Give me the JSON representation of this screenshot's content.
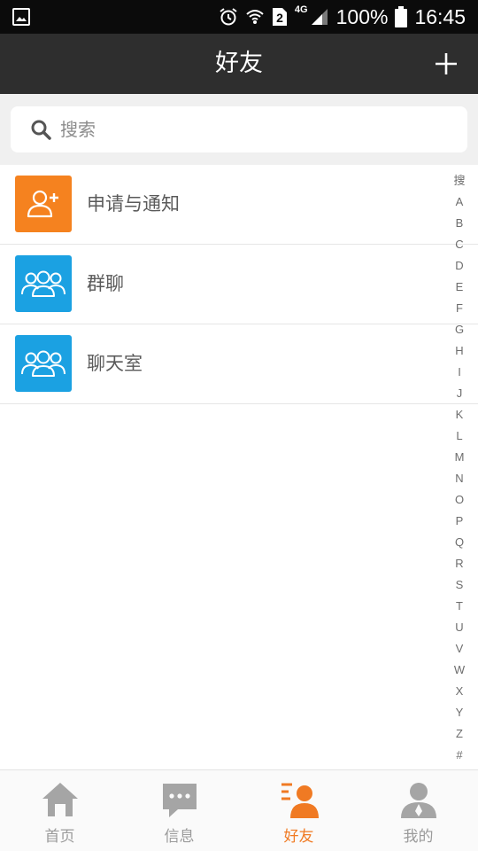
{
  "status_bar": {
    "network": "4G",
    "sim": "2",
    "battery": "100%",
    "time": "16:45"
  },
  "header": {
    "title": "好友",
    "add_icon": "plus-icon"
  },
  "search": {
    "placeholder": "搜索",
    "value": ""
  },
  "list": {
    "items": [
      {
        "label": "申请与通知",
        "icon": "add-user-icon",
        "color": "#f5821f"
      },
      {
        "label": "群聊",
        "icon": "group-icon",
        "color": "#1ba1e2"
      },
      {
        "label": "聊天室",
        "icon": "group-icon",
        "color": "#1ba1e2"
      }
    ]
  },
  "index": [
    "搜",
    "A",
    "B",
    "C",
    "D",
    "E",
    "F",
    "G",
    "H",
    "I",
    "J",
    "K",
    "L",
    "M",
    "N",
    "O",
    "P",
    "Q",
    "R",
    "S",
    "T",
    "U",
    "V",
    "W",
    "X",
    "Y",
    "Z",
    "#"
  ],
  "bottom_nav": {
    "items": [
      {
        "label": "首页",
        "icon": "home-icon"
      },
      {
        "label": "信息",
        "icon": "message-icon"
      },
      {
        "label": "好友",
        "icon": "friends-icon",
        "active": true
      },
      {
        "label": "我的",
        "icon": "profile-icon"
      }
    ]
  },
  "colors": {
    "accent": "#f07a23",
    "header_bg": "#2e2e2e",
    "inactive": "#9b9b9b"
  }
}
